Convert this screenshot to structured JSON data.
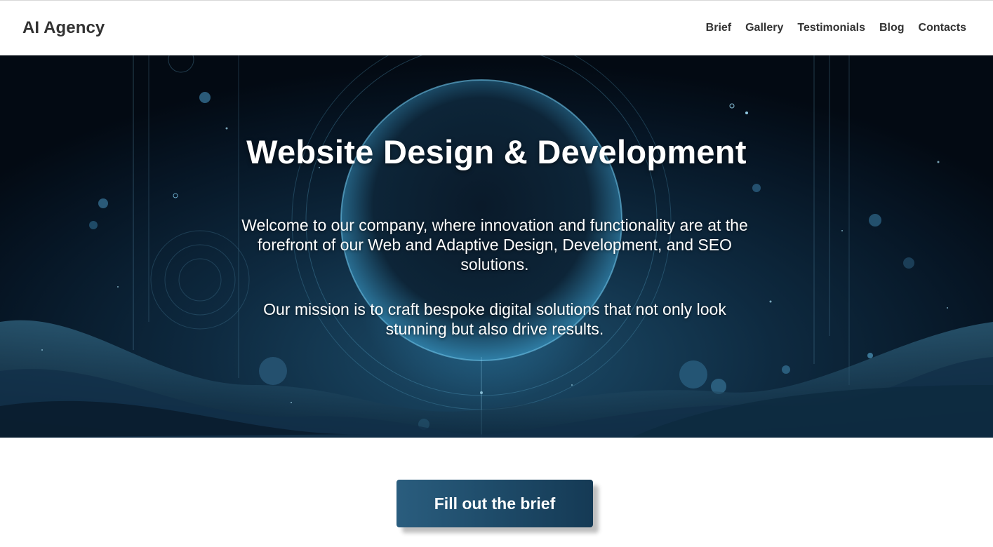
{
  "header": {
    "logo": "AI Agency",
    "nav": [
      "Brief",
      "Gallery",
      "Testimonials",
      "Blog",
      "Contacts"
    ]
  },
  "hero": {
    "title": "Website Design & Development",
    "intro": "Welcome to our company, where innovation and functionality are at the forefront of our Web and Adaptive Design, Development, and SEO solutions.",
    "mission": "Our mission is to craft bespoke digital solutions that not only look stunning but also drive results."
  },
  "cta": {
    "label": "Fill out the brief"
  },
  "colors": {
    "text_dark": "#333333",
    "hero_dark": "#061524",
    "hero_glow": "#50aad2",
    "cta_start": "#2a5d7e",
    "cta_end": "#153a55"
  }
}
